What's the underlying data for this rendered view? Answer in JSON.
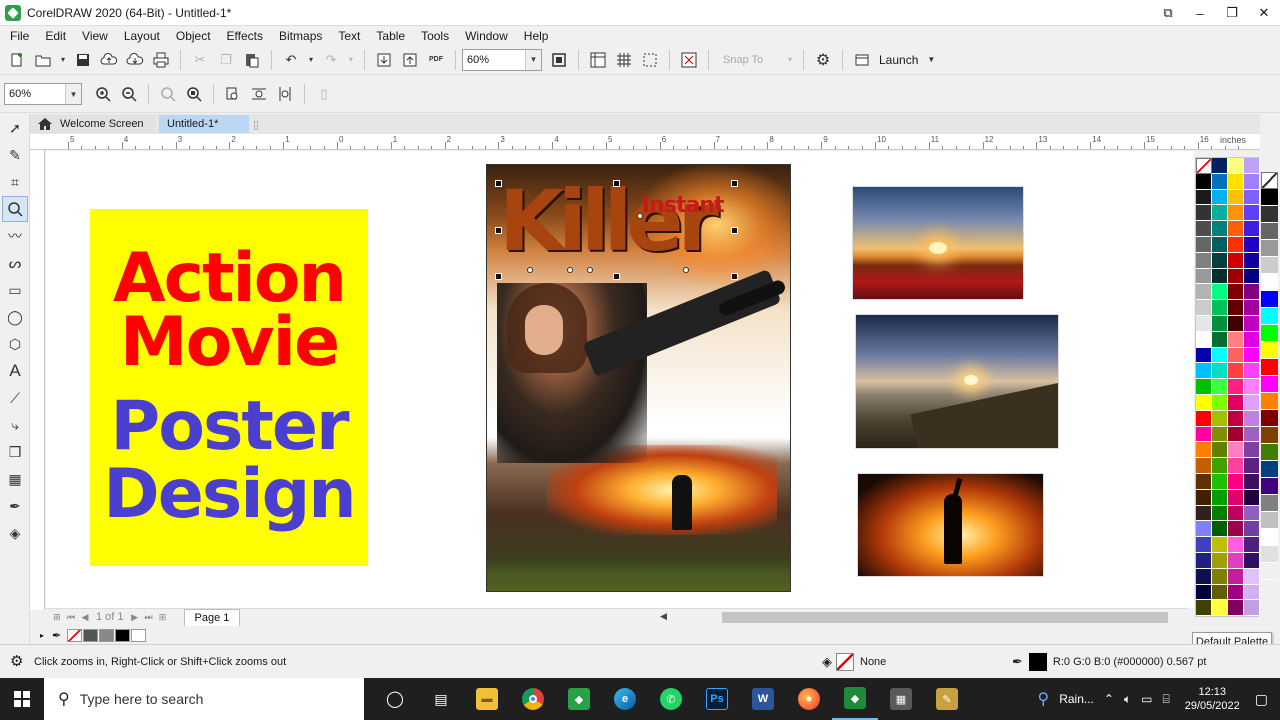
{
  "window": {
    "title": "CorelDRAW 2020 (64-Bit) - Untitled-1*",
    "controls": [
      "⧉",
      "–",
      "❐",
      "✕"
    ]
  },
  "menu": [
    "File",
    "Edit",
    "View",
    "Layout",
    "Object",
    "Effects",
    "Bitmaps",
    "Text",
    "Table",
    "Tools",
    "Window",
    "Help"
  ],
  "toolbar": {
    "zoom_value": "60%",
    "snap_to_label": "Snap To",
    "launch_label": "Launch",
    "pdf_label": "PDF"
  },
  "zoombar": {
    "zoom_value": "60%"
  },
  "tabs": {
    "welcome": "Welcome Screen",
    "document": "Untitled-1*"
  },
  "ruler": {
    "labels": [
      "5",
      "4",
      "3",
      "2",
      "1",
      "0",
      "1",
      "2",
      "3",
      "4",
      "5",
      "6",
      "7",
      "8",
      "9",
      "10",
      "11",
      "12",
      "13",
      "14",
      "15",
      "16"
    ],
    "unit": "inches"
  },
  "canvas": {
    "title_card": {
      "line1": "Action",
      "line2": "Movie",
      "line3": "Poster",
      "line4": "Design",
      "colors": {
        "bg": "#ffff00",
        "red": "#ff0000",
        "purple": "#4b3fd0"
      }
    },
    "poster": {
      "headline": "Killer",
      "subhead": "Instant"
    }
  },
  "pagenav": {
    "page_of": "1 of 1",
    "page_tab": "Page 1"
  },
  "palette": {
    "tooltip": "Default Palette"
  },
  "status": {
    "hint": "Click zooms in, Right-Click or Shift+Click zooms out",
    "fill": "None",
    "outline": "R:0 G:0 B:0 (#000000)  0.567 pt"
  },
  "taskbar": {
    "search_placeholder": "Type here to search",
    "weather": "Rain...",
    "time": "12:13",
    "date": "29/05/2022"
  }
}
